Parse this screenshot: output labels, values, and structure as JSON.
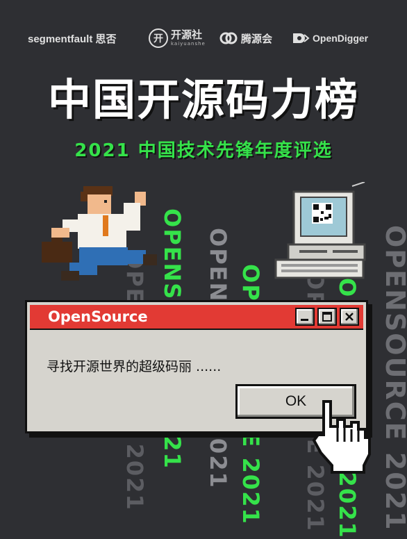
{
  "logos": {
    "segmentfault": "segmentfault 思否",
    "kaiyuanshe_main": "开源社",
    "kaiyuanshe_sub": "kaiyuanshe",
    "tengyuanhui": "腾源会",
    "opendigger": "OpenDigger"
  },
  "title": "中国开源码力榜",
  "subtitle": "2021 中国技术先锋年度评选",
  "background_text": {
    "col1": "OPENSOURCE 2021",
    "col2": "OPENSOURCE 2021",
    "col3": "OPENSOURCE 2021",
    "col4": "OPENSOURCE 2021",
    "col5": "OPENSOURCE 2021",
    "col6": "OPENSOURCE 2021",
    "col7": "OPENSOURCE 2021"
  },
  "dialog": {
    "title": "OpenSource",
    "message": "寻找开源世界的超级码丽 ......",
    "ok_label": "OK"
  },
  "colors": {
    "background": "#2e2f33",
    "accent_green": "#35e24a",
    "dialog_red": "#e23a34",
    "dialog_gray": "#d6d4ce"
  }
}
